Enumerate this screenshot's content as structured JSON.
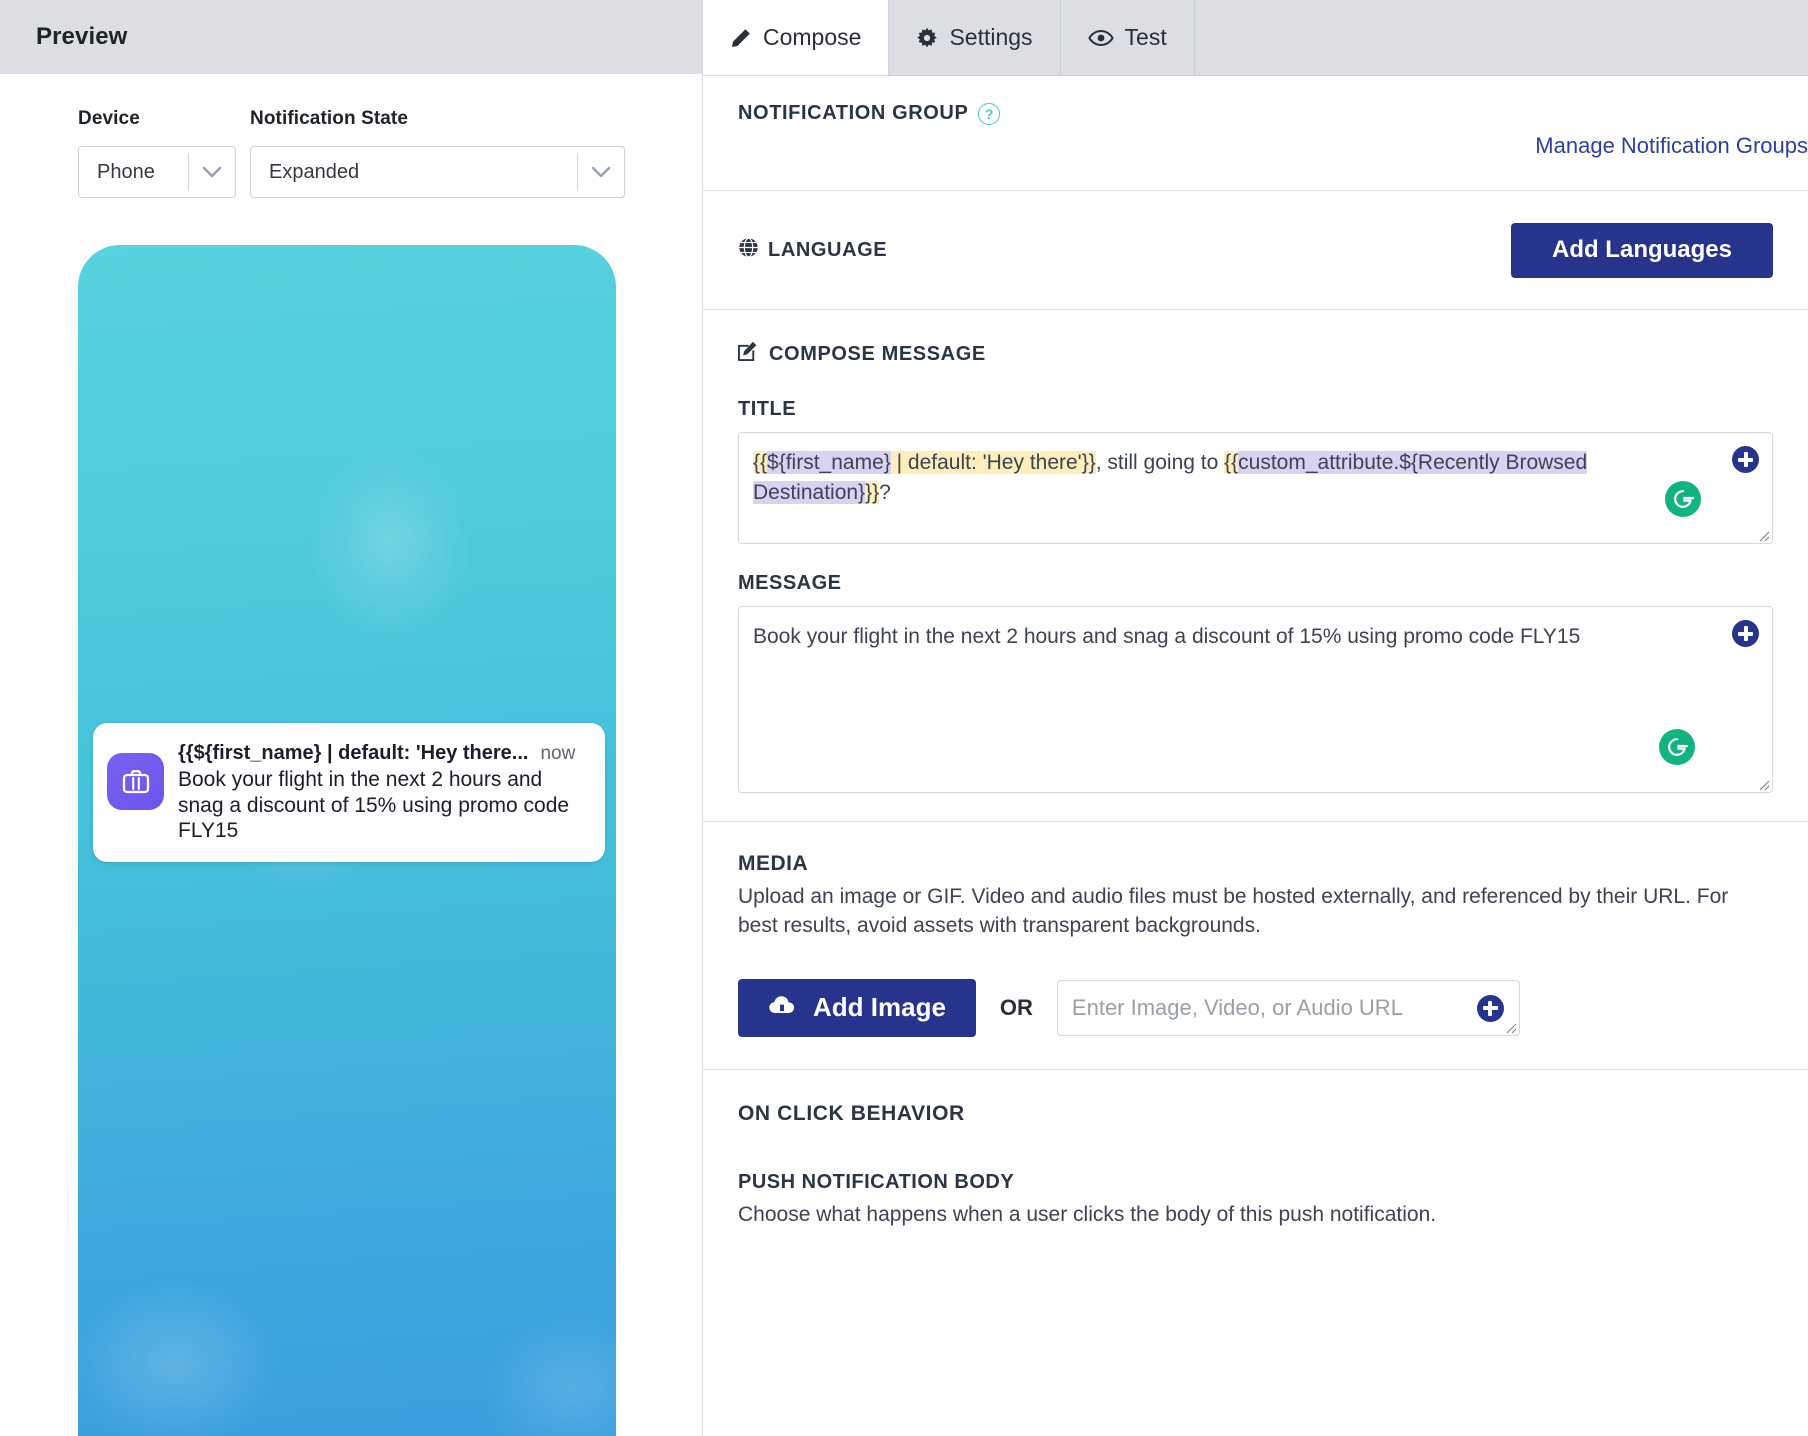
{
  "preview": {
    "header_title": "Preview",
    "device": {
      "label": "Device",
      "value": "Phone"
    },
    "notification_state": {
      "label": "Notification State",
      "value": "Expanded"
    },
    "notification": {
      "title": "{{${first_name} | default: 'Hey there...",
      "time": "now",
      "body": "Book your flight in the next 2 hours and snag a discount of 15% using promo code FLY15",
      "icon": "briefcase-icon",
      "icon_color": "#6b55ed"
    },
    "background_gradient": {
      "from": "#58d2dd",
      "to": "#3a9fdd"
    }
  },
  "tabs": [
    {
      "label": "Compose",
      "icon": "pencil-icon",
      "active": true
    },
    {
      "label": "Settings",
      "icon": "gear-icon",
      "active": false
    },
    {
      "label": "Test",
      "icon": "eye-icon",
      "active": false
    }
  ],
  "notification_group": {
    "heading": "NOTIFICATION GROUP",
    "help_icon": "question-mark-icon",
    "manage_link": "Manage Notification Groups"
  },
  "language": {
    "heading": "LANGUAGE",
    "icon": "globe-icon",
    "add_button": "Add Languages"
  },
  "compose": {
    "heading": "COMPOSE MESSAGE",
    "icon": "compose-pencil-icon",
    "title": {
      "label": "TITLE",
      "value": "{{${first_name} | default: 'Hey there'}}, still going to {{custom_attribute.${Recently Browsed Destination}}}?",
      "segments": [
        {
          "text": "{{",
          "highlight": "yellow"
        },
        {
          "text": "${first_name}",
          "highlight": "purple"
        },
        {
          "text": " | default: 'Hey there'}}",
          "highlight": "yellow"
        },
        {
          "text": ", still going to ",
          "highlight": "none"
        },
        {
          "text": "{{",
          "highlight": "yellow"
        },
        {
          "text": "custom_attribute.${Recently Browsed Destination}",
          "highlight": "purple"
        },
        {
          "text": "}}",
          "highlight": "yellow"
        },
        {
          "text": "?",
          "highlight": "none"
        }
      ],
      "grammarly_icon": "grammarly-icon",
      "add_icon": "plus-circle-icon"
    },
    "message": {
      "label": "MESSAGE",
      "value": "Book your flight in the next 2 hours and snag a discount of 15% using promo code FLY15",
      "grammarly_icon": "grammarly-icon",
      "add_icon": "plus-circle-icon"
    }
  },
  "media": {
    "heading": "MEDIA",
    "description": "Upload an image or GIF. Video and audio files must be hosted externally, and referenced by their URL. For best results, avoid assets with transparent backgrounds.",
    "add_image_button": "Add Image",
    "add_image_icon": "cloud-upload-icon",
    "or_text": "OR",
    "url_placeholder": "Enter Image, Video, or Audio URL",
    "url_value": ""
  },
  "on_click": {
    "heading": "ON CLICK BEHAVIOR",
    "push_body_title": "PUSH NOTIFICATION BODY",
    "push_body_desc": "Choose what happens when a user clicks the body of this push notification."
  },
  "colors": {
    "brand_navy": "#27348b",
    "link_blue": "#2e3fa0",
    "grammarly_green": "#11b383",
    "help_teal": "#3ecfb2",
    "highlight_yellow": "#fdeebb",
    "highlight_purple": "#d9d2f5"
  }
}
